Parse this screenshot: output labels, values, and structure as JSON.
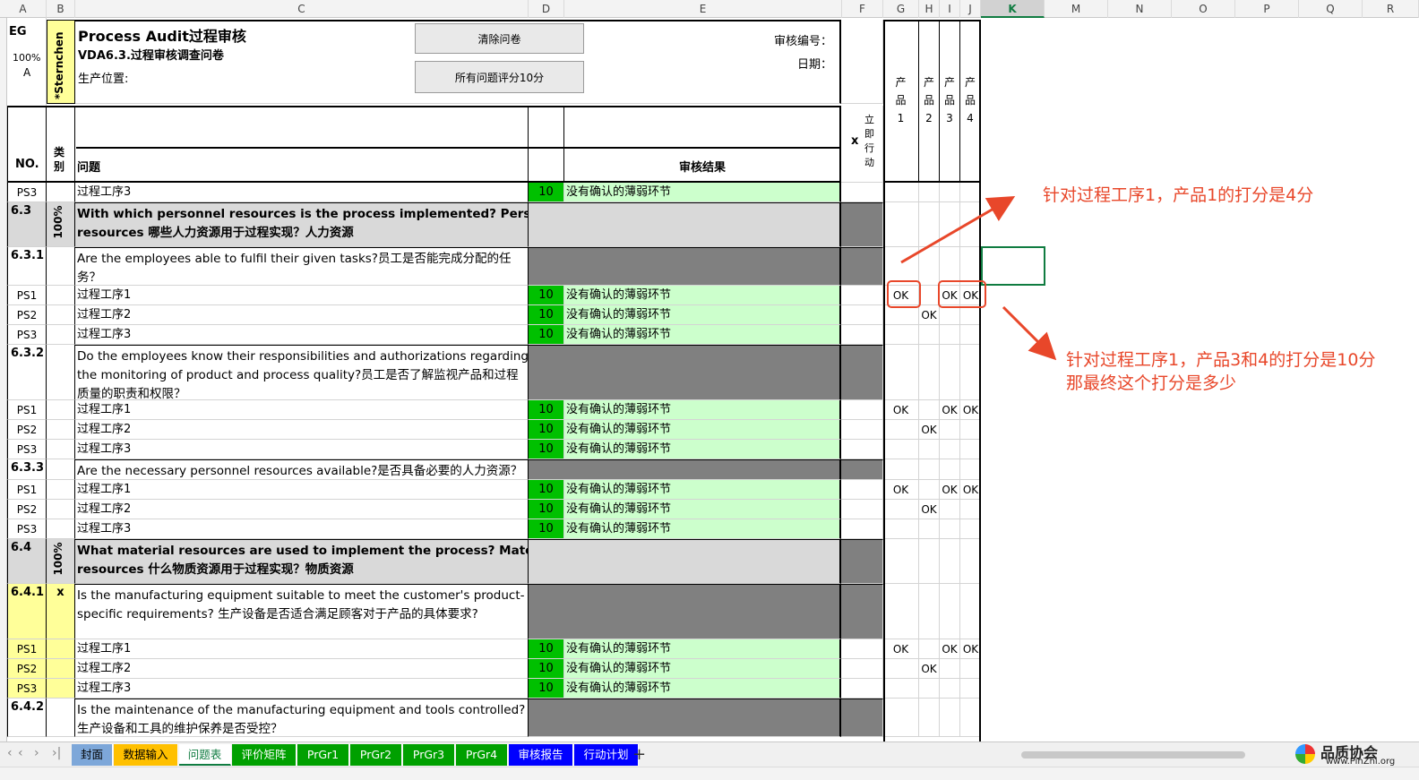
{
  "columns": [
    "A",
    "B",
    "C",
    "D",
    "E",
    "F",
    "G",
    "H",
    "I",
    "J",
    "K",
    "M",
    "N",
    "O",
    "P",
    "Q",
    "R"
  ],
  "selected_column": "K",
  "header": {
    "eg": "EG",
    "pct": "100%",
    "letter": "A",
    "sternchen": "*Sternchen",
    "title": "Process Audit过程审核",
    "subtitle": "VDA6.3.过程审核调查问卷",
    "location": "生产位置:",
    "audit_no": "审核编号：",
    "date": "日期：",
    "clear_btn": "清除问卷",
    "score_btn": "所有问题评分10分",
    "products": [
      "产品1",
      "产品2",
      "产品3",
      "产品4"
    ]
  },
  "col_headers": {
    "no": "NO.",
    "cat": "类别",
    "question": "问题",
    "result": "审核结果",
    "x": "x",
    "action": "立即行动"
  },
  "rows": [
    {
      "type": "ps",
      "no": "PS3",
      "q": "过程工序3",
      "score": "10",
      "res": "没有确认的薄弱环节"
    },
    {
      "type": "sec",
      "no": "6.3",
      "cat": "100%",
      "q1": "With which personnel resources is the process implemented?  Personnel",
      "q2": "resources 哪些人力资源用于过程实现？人力资源"
    },
    {
      "type": "q",
      "no": "6.3.1",
      "q1": "Are the employees able to fulfil their given tasks?员工是否能完成分配的任",
      "q2": "务？"
    },
    {
      "type": "ps",
      "no": "PS1",
      "q": "过程工序1",
      "score": "10",
      "res": "没有确认的薄弱环节",
      "ok": [
        "OK",
        "",
        "OK",
        "OK"
      ]
    },
    {
      "type": "ps",
      "no": "PS2",
      "q": "过程工序2",
      "score": "10",
      "res": "没有确认的薄弱环节",
      "ok": [
        "",
        "OK",
        "",
        ""
      ]
    },
    {
      "type": "ps",
      "no": "PS3",
      "q": "过程工序3",
      "score": "10",
      "res": "没有确认的薄弱环节"
    },
    {
      "type": "q3",
      "no": "6.3.2",
      "q1": "Do the employees know their responsibilities and authorizations regarding",
      "q2": "the monitoring of product and process quality?员工是否了解监视产品和过程",
      "q3": "质量的职责和权限？"
    },
    {
      "type": "ps",
      "no": "PS1",
      "q": "过程工序1",
      "score": "10",
      "res": "没有确认的薄弱环节",
      "ok": [
        "OK",
        "",
        "OK",
        "OK"
      ]
    },
    {
      "type": "ps",
      "no": "PS2",
      "q": "过程工序2",
      "score": "10",
      "res": "没有确认的薄弱环节",
      "ok": [
        "",
        "OK",
        "",
        ""
      ]
    },
    {
      "type": "ps",
      "no": "PS3",
      "q": "过程工序3",
      "score": "10",
      "res": "没有确认的薄弱环节"
    },
    {
      "type": "q1",
      "no": "6.3.3",
      "q1": "Are the necessary personnel resources available?是否具备必要的人力资源？"
    },
    {
      "type": "ps",
      "no": "PS1",
      "q": "过程工序1",
      "score": "10",
      "res": "没有确认的薄弱环节",
      "ok": [
        "OK",
        "",
        "OK",
        "OK"
      ]
    },
    {
      "type": "ps",
      "no": "PS2",
      "q": "过程工序2",
      "score": "10",
      "res": "没有确认的薄弱环节",
      "ok": [
        "",
        "OK",
        "",
        ""
      ]
    },
    {
      "type": "ps",
      "no": "PS3",
      "q": "过程工序3",
      "score": "10",
      "res": "没有确认的薄弱环节"
    },
    {
      "type": "sec",
      "no": "6.4",
      "cat": "100%",
      "q1": "What material resources are used to implement the process? Material",
      "q2": "resources 什么物质资源用于过程实现？物质资源"
    },
    {
      "type": "qy",
      "no": "6.4.1",
      "cat": "x",
      "q1": "Is the manufacturing equipment suitable to meet the customer's product-",
      "q2": "specific requirements? 生产设备是否适合满足顾客对于产品的具体要求?"
    },
    {
      "type": "psy",
      "no": "PS1",
      "q": "过程工序1",
      "score": "10",
      "res": "没有确认的薄弱环节",
      "ok": [
        "OK",
        "",
        "OK",
        "OK"
      ]
    },
    {
      "type": "psy",
      "no": "PS2",
      "q": "过程工序2",
      "score": "10",
      "res": "没有确认的薄弱环节",
      "ok": [
        "",
        "OK",
        "",
        ""
      ]
    },
    {
      "type": "psy",
      "no": "PS3",
      "q": "过程工序3",
      "score": "10",
      "res": "没有确认的薄弱环节"
    },
    {
      "type": "q",
      "no": "6.4.2",
      "q1": "Is the maintenance of the manufacturing equipment and tools controlled?",
      "q2": "生产设备和工具的维护保养是否受控？"
    }
  ],
  "annotations": {
    "a1": "针对过程工序1，产品1的打分是4分",
    "a2": "针对过程工序1，产品3和4的打分是10分",
    "a3": "那最终这个打分是多少",
    "color": "#e8472a"
  },
  "tabs": [
    {
      "label": "封面",
      "color": "#7da7d9",
      "text": "#000"
    },
    {
      "label": "数据输入",
      "color": "#ffc000",
      "text": "#000"
    },
    {
      "label": "问题表",
      "color": "#ffffff",
      "text": "#107c41"
    },
    {
      "label": "评价矩阵",
      "color": "#00a000",
      "text": "#fff"
    },
    {
      "label": "PrGr1",
      "color": "#00a000",
      "text": "#fff"
    },
    {
      "label": "PrGr2",
      "color": "#00a000",
      "text": "#fff"
    },
    {
      "label": "PrGr3",
      "color": "#00a000",
      "text": "#fff"
    },
    {
      "label": "PrGr4",
      "color": "#00a000",
      "text": "#fff"
    },
    {
      "label": "审核报告",
      "color": "#0000ff",
      "text": "#fff"
    },
    {
      "label": "行动计划",
      "color": "#0000ff",
      "text": "#fff"
    }
  ],
  "add_tab": "+",
  "watermark": {
    "name": "品质协会",
    "url": "www.PinZhi.org"
  }
}
